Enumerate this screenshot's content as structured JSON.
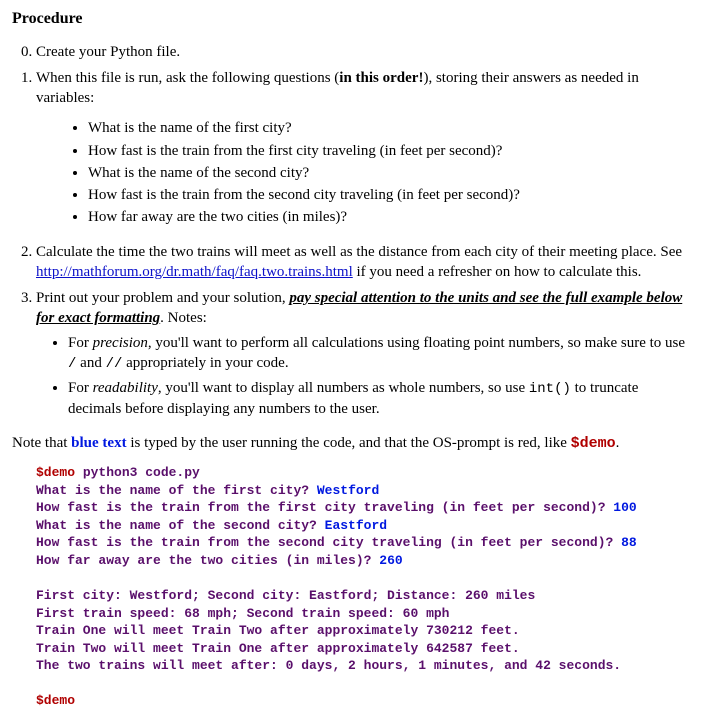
{
  "heading": "Procedure",
  "steps": {
    "s0": "Create your Python file.",
    "s1_a": "When this file is run, ask the following questions (",
    "s1_b": "in this order!",
    "s1_c": "), storing their answers as needed in variables:",
    "questions": [
      "What is the name of the first city?",
      "How fast is the train from the first city traveling (in feet per second)?",
      "What is the name of the second city?",
      "How fast is the train from the second city traveling (in feet per second)?",
      "How far away are the two cities (in miles)?"
    ],
    "s2_a": "Calculate the time the two trains will meet as well as the distance from each city of their meeting place. See ",
    "s2_link": "http://mathforum.org/dr.math/faq/faq.two.trains.html",
    "s2_b": " if you need a refresher on how to calculate this.",
    "s3_a": "Print out your problem and your solution, ",
    "s3_b": "pay special attention to the units and see the full example below for exact formatting",
    "s3_c": ". Notes:",
    "s3_bullets": {
      "b1_a": "For ",
      "b1_b": "precision",
      "b1_c": ", you'll want to perform all calculations using floating point numbers, so make sure to use ",
      "b1_d": "/",
      "b1_e": " and ",
      "b1_f": "//",
      "b1_g": " appropriately in your code.",
      "b2_a": "For ",
      "b2_b": "readability",
      "b2_c": ", you'll want to display all numbers as whole numbers, so use ",
      "b2_d": "int()",
      "b2_e": " to truncate decimals before displaying any numbers to the user."
    }
  },
  "note": {
    "a": "Note that ",
    "b": "blue text",
    "c": " is typed by the user running the code, and that the OS-prompt is red, like ",
    "d": "$demo",
    "e": "."
  },
  "code": {
    "l1_a": "$demo ",
    "l1_b": "python3 code.py",
    "l2_a": "What is the name of the first city? ",
    "l2_b": "Westford",
    "l3_a": "How fast is the train from the first city traveling (in feet per second)? ",
    "l3_b": "100",
    "l4_a": "What is the name of the second city? ",
    "l4_b": "Eastford",
    "l5_a": "How fast is the train from the second city traveling (in feet per second)? ",
    "l5_b": "88",
    "l6_a": "How far away are the two cities (in miles)? ",
    "l6_b": "260",
    "l7": "",
    "l8": "First city: Westford; Second city: Eastford; Distance: 260 miles",
    "l9": "First train speed: 68 mph; Second train speed: 60 mph",
    "l10": "Train One will meet Train Two after approximately 730212 feet.",
    "l11": "Train Two will meet Train One after approximately 642587 feet.",
    "l12": "The two trains will meet after: 0 days, 2 hours, 1 minutes, and 42 seconds.",
    "l13": "",
    "l14": "$demo"
  }
}
